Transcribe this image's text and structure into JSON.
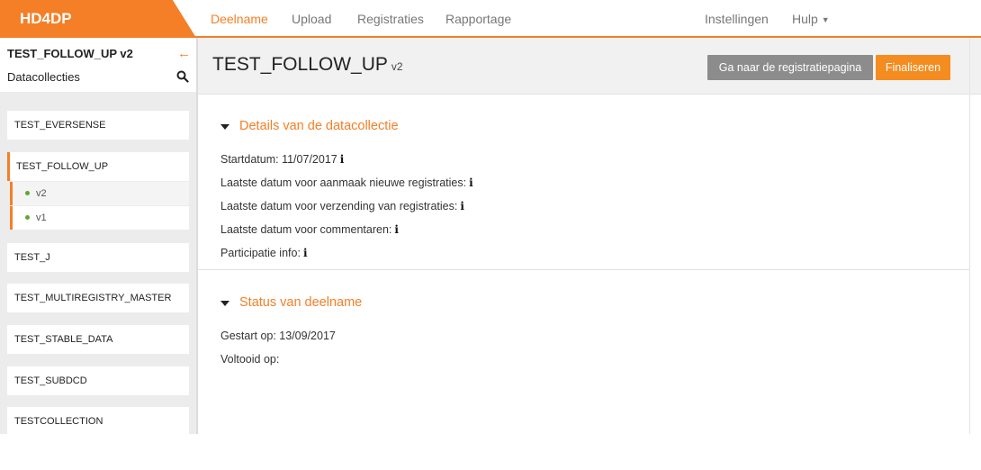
{
  "app": {
    "brand": "HD4DP"
  },
  "nav": {
    "items": [
      "Deelname",
      "Upload",
      "Registraties",
      "Rapportage"
    ],
    "settings": "Instellingen",
    "help": "Hulp"
  },
  "sidebar": {
    "title": "TEST_FOLLOW_UP v2",
    "subtitle": "Datacollecties",
    "items": [
      {
        "label": "TEST_EVERSENSE"
      },
      {
        "label": "TEST_FOLLOW_UP"
      },
      {
        "label": "TEST_J"
      },
      {
        "label": "TEST_MULTIREGISTRY_MASTER"
      },
      {
        "label": "TEST_STABLE_DATA"
      },
      {
        "label": "TEST_SUBDCD"
      },
      {
        "label": "TESTCOLLECTION"
      }
    ],
    "versions": [
      "v2",
      "v1"
    ]
  },
  "main": {
    "title": "TEST_FOLLOW_UP",
    "version": "v2",
    "btn_registry": "Ga naar de registratiepagina",
    "btn_finalize": "Finaliseren",
    "details": {
      "title": "Details van de datacollectie",
      "lines": [
        "Startdatum: 11/07/2017",
        "Laatste datum voor aanmaak nieuwe registraties:",
        "Laatste datum voor verzending van registraties:",
        "Laatste datum voor commentaren:",
        "Participatie info:"
      ]
    },
    "status": {
      "title": "Status van deelname",
      "started": "Gestart op: 13/09/2017",
      "completed": "Voltooid op:"
    }
  },
  "colors": {
    "accent": "#f47f26",
    "button_grey": "#8c8c8c",
    "button_orange": "#f58c1f",
    "version_dot": "#5ea832"
  },
  "icons": {
    "collapse": "arrow-left-icon",
    "search": "search-icon",
    "info": "info-icon",
    "toggle": "caret-down-icon"
  }
}
